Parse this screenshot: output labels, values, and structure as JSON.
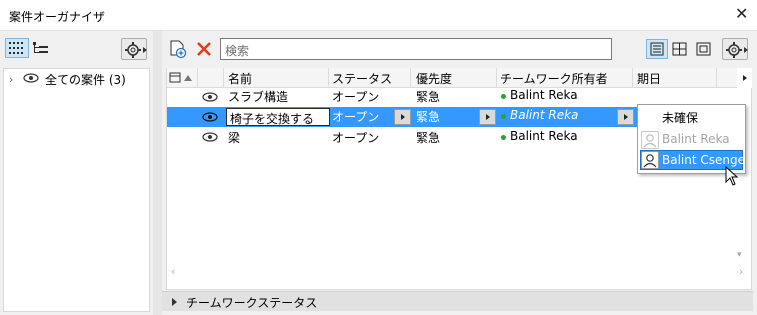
{
  "window": {
    "title": "案件オーガナイザ",
    "close_icon": "close-icon"
  },
  "left": {
    "tree_root": {
      "label": "全ての案件 (3)"
    }
  },
  "toolbar": {
    "search_placeholder": "検索"
  },
  "columns": [
    "名前",
    "ステータス",
    "優先度",
    "チームワーク所有者",
    "期日"
  ],
  "rows": [
    {
      "name": "スラブ構造",
      "status": "オープン",
      "priority": "緊急",
      "owner": "Balint Reka",
      "due": ""
    },
    {
      "name": "椅子を交換する",
      "status": "オープン",
      "priority": "緊急",
      "owner": "Balint Reka",
      "due": ""
    },
    {
      "name": "梁",
      "status": "オープン",
      "priority": "緊急",
      "owner": "Balint Reka",
      "due": ""
    }
  ],
  "owner_popup": {
    "items": [
      "未確保",
      "Balint Reka",
      "Balint Csenge"
    ],
    "selected": "Balint Csenge"
  },
  "footer": {
    "label": "チームワークステータス"
  },
  "colors": {
    "selection": "#3399ff",
    "online_dot": "#29a329",
    "delete_x": "#e8381a"
  }
}
